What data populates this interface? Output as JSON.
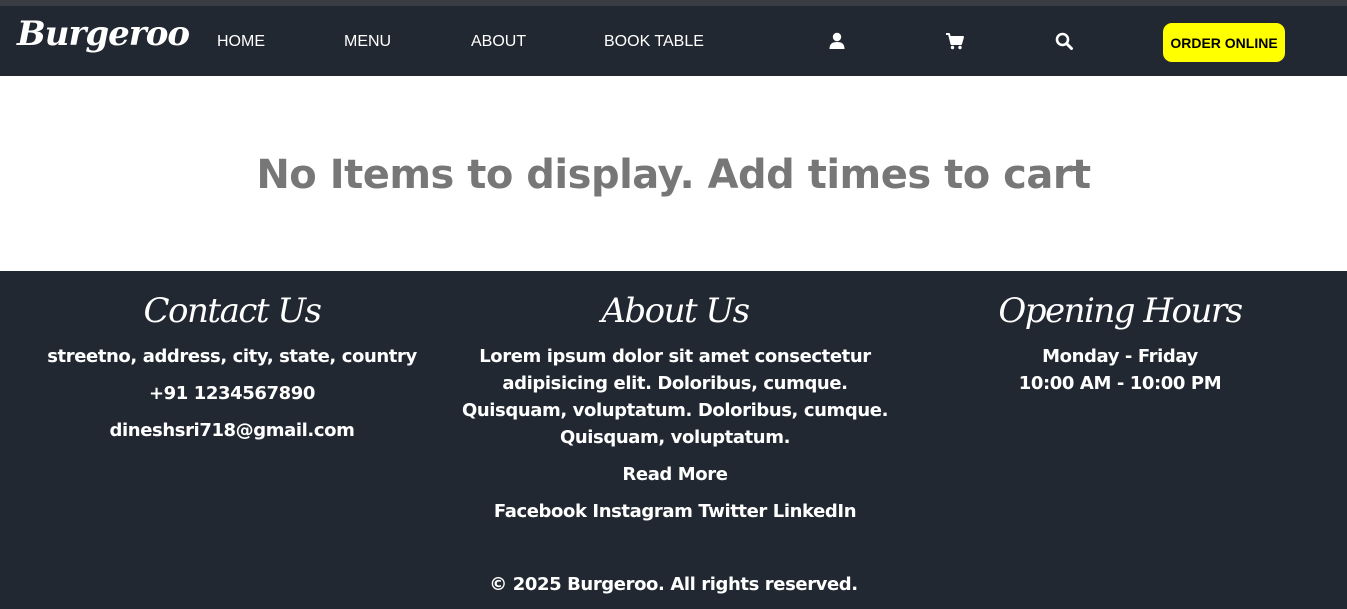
{
  "navbar": {
    "brand": "Burgeroo",
    "links": [
      "HOME",
      "MENU",
      "ABOUT",
      "BOOK TABLE"
    ],
    "icons": [
      "user-icon",
      "cart-icon",
      "search-icon"
    ],
    "order_button": "ORDER ONLINE",
    "colors": {
      "background": "#222831",
      "order_button": "#ffff00"
    }
  },
  "main": {
    "message": "No Items to display. Add times to cart"
  },
  "footer": {
    "contact": {
      "title": "Contact Us",
      "address": "streetno, address, city, state, country",
      "phone": "+91 1234567890",
      "email": "dineshsri718@gmail.com"
    },
    "about": {
      "title": "About Us",
      "text": "Lorem ipsum dolor sit amet consectetur adipisicing elit. Doloribus, cumque. Quisquam, voluptatum. Doloribus, cumque. Quisquam, voluptatum.",
      "read_more": "Read More",
      "socials": [
        "Facebook",
        "Instagram",
        "Twitter",
        "LinkedIn"
      ]
    },
    "hours": {
      "title": "Opening Hours",
      "days": "Monday - Friday",
      "time": "10:00 AM - 10:00 PM"
    },
    "copyright": "© 2025 Burgeroo. All rights reserved."
  }
}
